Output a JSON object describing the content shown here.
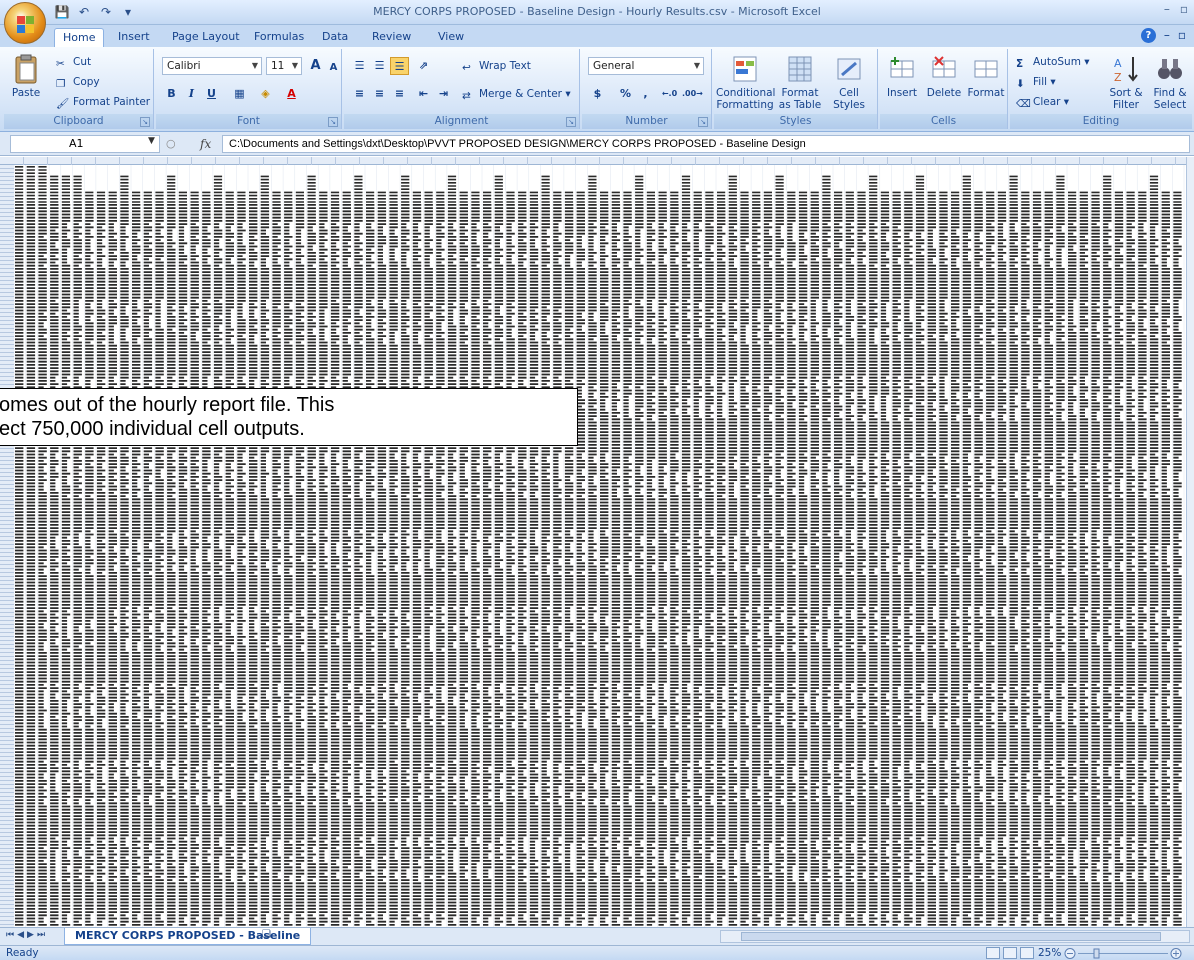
{
  "window": {
    "title": "MERCY CORPS PROPOSED - Baseline Design - Hourly Results.csv - Microsoft Excel"
  },
  "tabs": [
    {
      "label": "Home",
      "active": true
    },
    {
      "label": "Insert"
    },
    {
      "label": "Page Layout"
    },
    {
      "label": "Formulas"
    },
    {
      "label": "Data"
    },
    {
      "label": "Review"
    },
    {
      "label": "View"
    }
  ],
  "ribbon": {
    "clipboard": {
      "label": "Clipboard",
      "paste": "Paste",
      "cut": "Cut",
      "copy": "Copy",
      "format_painter": "Format Painter"
    },
    "font": {
      "label": "Font",
      "name": "Calibri",
      "size": "11",
      "bold": "B",
      "italic": "I",
      "underline": "U",
      "grow": "A",
      "shrink": "A"
    },
    "alignment": {
      "label": "Alignment",
      "wrap": "Wrap Text",
      "merge": "Merge & Center"
    },
    "number": {
      "label": "Number",
      "format": "General",
      "currency": "$",
      "percent": "%",
      "comma": ","
    },
    "styles": {
      "label": "Styles",
      "conditional": "Conditional Formatting",
      "table": "Format as Table",
      "cell": "Cell Styles"
    },
    "cells": {
      "label": "Cells",
      "insert": "Insert",
      "delete": "Delete",
      "format": "Format"
    },
    "editing": {
      "label": "Editing",
      "autosum": "AutoSum",
      "fill": "Fill",
      "clear": "Clear",
      "sort": "Sort & Filter",
      "find": "Find & Select"
    }
  },
  "formula_bar": {
    "name_box": "A1",
    "fx": "fx",
    "value": "C:\\Documents and Settings\\dxt\\Desktop\\PVVT PROPOSED DESIGN\\MERCY CORPS PROPOSED - Baseline Design"
  },
  "callout": {
    "line1": "omes out of the hourly report file. This",
    "line2": "ect 750,000 individual cell outputs."
  },
  "sheet_tab": "MERCY CORPS PROPOSED - Baseline",
  "status": {
    "ready": "Ready",
    "zoom": "25%"
  },
  "colors": {
    "ribbon_text": "#15428b",
    "ribbon_bg": "#dbe8f9",
    "office_orange": "#e48d18"
  }
}
